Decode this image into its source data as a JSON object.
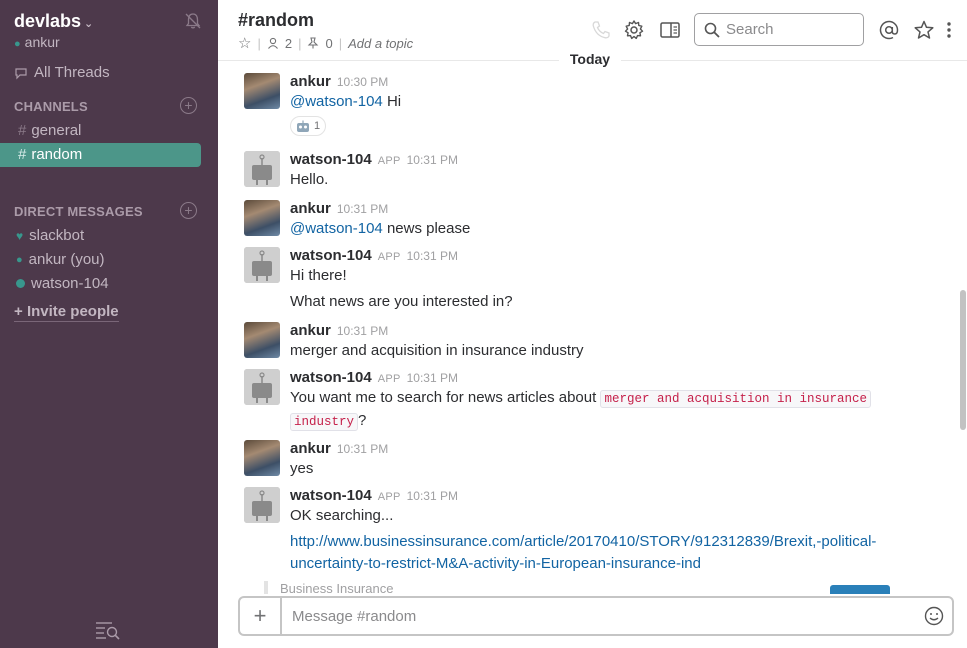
{
  "sidebar": {
    "team_name": "devlabs",
    "user_name": "ankur",
    "all_threads": "All Threads",
    "channels_heading": "CHANNELS",
    "channels": [
      {
        "name": "general",
        "active": false
      },
      {
        "name": "random",
        "active": true
      }
    ],
    "dm_heading": "DIRECT MESSAGES",
    "dms": [
      {
        "name": "slackbot",
        "icon": "heart-icon"
      },
      {
        "name": "ankur (you)",
        "icon": "presence-icon"
      },
      {
        "name": "watson-104",
        "icon": "presence-dot"
      }
    ],
    "invite_label": "Invite people",
    "colors": {
      "background": "#4d394b",
      "active_channel": "#4c9689",
      "presence": "#38978d"
    }
  },
  "header": {
    "channel_title": "#random",
    "members_count": "2",
    "pins_count": "0",
    "topic_placeholder": "Add a topic",
    "search_placeholder": "Search"
  },
  "messages": {
    "day_divider": "Today",
    "items": [
      {
        "author": "ankur",
        "is_app": false,
        "time": "10:30 PM",
        "mention": "@watson-104",
        "text": " Hi",
        "reaction_count": "1"
      },
      {
        "author": "watson-104",
        "is_app": true,
        "app_label": "APP",
        "time": "10:31 PM",
        "text": "Hello."
      },
      {
        "author": "ankur",
        "is_app": false,
        "time": "10:31 PM",
        "mention": "@watson-104",
        "text": " news please"
      },
      {
        "author": "watson-104",
        "is_app": true,
        "app_label": "APP",
        "time": "10:31 PM",
        "text": "Hi there!",
        "text2": "What news are you interested in?"
      },
      {
        "author": "ankur",
        "is_app": false,
        "time": "10:31 PM",
        "text": "merger and acquisition in insurance industry"
      },
      {
        "author": "watson-104",
        "is_app": true,
        "app_label": "APP",
        "time": "10:31 PM",
        "text_before": "You want me to search for news articles about ",
        "code_line1": "merger and acquisition in insurance",
        "code_line2": "industry",
        "text_after": "?"
      },
      {
        "author": "ankur",
        "is_app": false,
        "time": "10:31 PM",
        "text": "yes"
      },
      {
        "author": "watson-104",
        "is_app": true,
        "app_label": "APP",
        "time": "10:31 PM",
        "text": "OK searching...",
        "link_line1": "http://www.businessinsurance.com/article/20170410/STORY/912312839/Brexit,-political-",
        "link_line2": "uncertainty-to-restrict-M&A-activity-in-European-insurance-ind",
        "attachment_title": "Business Insurance"
      }
    ]
  },
  "composer": {
    "placeholder": "Message #random"
  }
}
